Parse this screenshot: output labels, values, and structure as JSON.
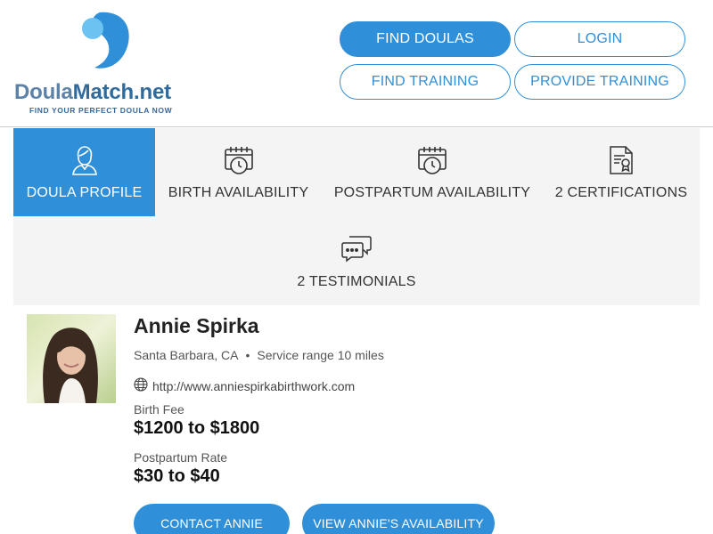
{
  "header": {
    "logo_part1": "Doula",
    "logo_part2": "Match.net",
    "logo_tagline": "FIND YOUR PERFECT DOULA NOW",
    "nav": {
      "find_doulas": "FIND DOULAS",
      "login": "LOGIN",
      "find_training": "FIND TRAINING",
      "provide_training": "PROVIDE TRAINING"
    }
  },
  "tabs": [
    {
      "label": "DOULA PROFILE",
      "icon": "doula-person-icon",
      "active": true
    },
    {
      "label": "BIRTH AVAILABILITY",
      "icon": "calendar-clock-icon",
      "active": false
    },
    {
      "label": "POSTPARTUM AVAILABILITY",
      "icon": "calendar-clock-icon",
      "active": false
    },
    {
      "label": "2 CERTIFICATIONS",
      "icon": "certificate-icon",
      "active": false
    },
    {
      "label": "2 TESTIMONIALS",
      "icon": "chat-bubbles-icon",
      "active": false
    }
  ],
  "profile": {
    "name": "Annie Spirka",
    "location": "Santa Barbara, CA",
    "separator": "•",
    "service_range": "Service range 10 miles",
    "website": "http://www.anniespirkabirthwork.com",
    "birth_fee_label": "Birth Fee",
    "birth_fee_value": "$1200 to $1800",
    "postpartum_label": "Postpartum Rate",
    "postpartum_value": "$30 to $40"
  },
  "actions": {
    "contact": "CONTACT ANNIE",
    "availability": "VIEW ANNIE'S AVAILABILITY"
  },
  "colors": {
    "accent": "#2f8fd8",
    "tab_bg": "#f4f4f4",
    "logo_dark": "#2f6b9c",
    "logo_light": "#5d82a8"
  }
}
